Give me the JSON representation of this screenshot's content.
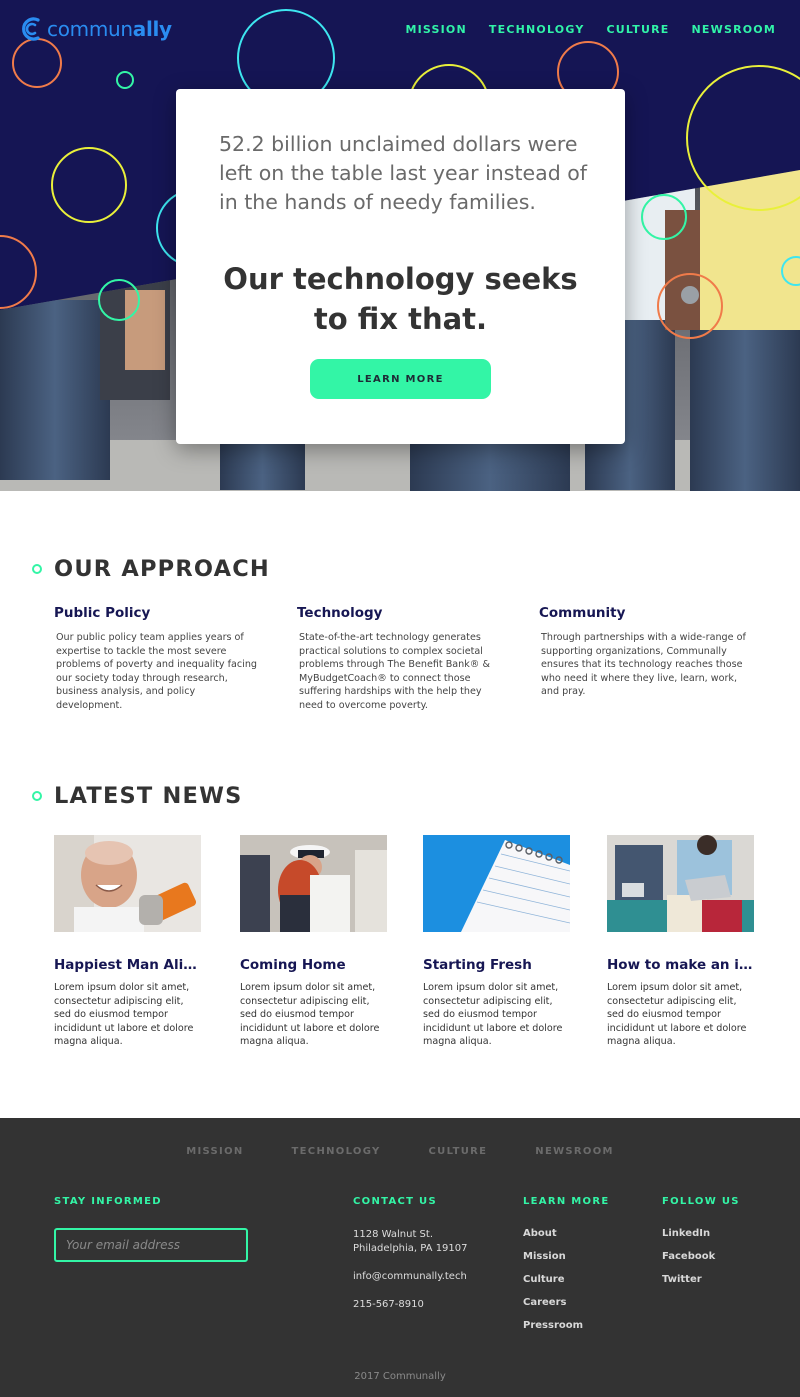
{
  "brand": {
    "logo_text_light": "commun",
    "logo_text_bold": "ally",
    "accent": "#33f5a6",
    "navy": "#151554",
    "logo_blue": "#2a8cf0"
  },
  "nav": {
    "items": [
      "MISSION",
      "TECHNOLOGY",
      "CULTURE",
      "NEWSROOM"
    ]
  },
  "hero": {
    "stat": "52.2 billion unclaimed dollars were left on the table last year instead of in the hands of needy families.",
    "headline_line1": "Our technology seeks",
    "headline_line2": "to fix that.",
    "button": "LEARN MORE"
  },
  "approach": {
    "title": "OUR APPROACH",
    "columns": [
      {
        "title": "Public Policy",
        "body": "Our public policy team applies years of expertise to tackle the most severe problems of poverty and inequality facing our society today through research, business analysis, and policy development."
      },
      {
        "title": "Technology",
        "body": "State-of-the-art technology generates practical solutions to complex societal problems through The Benefit Bank® & MyBudgetCoach® to connect those suffering hardships with the help they need to overcome poverty."
      },
      {
        "title": "Community",
        "body": "Through partnerships with a wide-range of supporting organizations, Communally ensures that its technology reaches those who need it where they live, learn, work, and pray."
      }
    ]
  },
  "news": {
    "title": "LATEST NEWS",
    "items": [
      {
        "title": "Happiest Man Alive?",
        "body": "Lorem ipsum dolor sit amet, consectetur adipiscing elit, sed do eiusmod tempor incididunt ut labore et dolore magna aliqua.",
        "image": "smiling-man-photo"
      },
      {
        "title": "Coming Home",
        "body": "Lorem ipsum dolor sit amet, consectetur adipiscing elit, sed do eiusmod tempor incididunt ut labore et dolore magna aliqua.",
        "image": "sailor-hug-photo"
      },
      {
        "title": "Starting Fresh",
        "body": "Lorem ipsum dolor sit amet, consectetur adipiscing elit, sed do eiusmod tempor incididunt ut labore et dolore magna aliqua.",
        "image": "notepad-photo"
      },
      {
        "title": "How to make an im...",
        "body": "Lorem ipsum dolor sit amet, consectetur adipiscing elit, sed do eiusmod tempor incididunt ut labore et dolore magna aliqua.",
        "image": "laptop-people-photo"
      }
    ]
  },
  "footer": {
    "nav": [
      "MISSION",
      "TECHNOLOGY",
      "CULTURE",
      "NEWSROOM"
    ],
    "stay_informed": {
      "title": "STAY INFORMED",
      "placeholder": "Your email address"
    },
    "contact": {
      "title": "CONTACT US",
      "address1": "1128 Walnut St.",
      "address2": "Philadelphia, PA 19107",
      "email": "info@communally.tech",
      "phone": "215-567-8910"
    },
    "learn_more": {
      "title": "LEARN MORE",
      "links": [
        "About",
        "Mission",
        "Culture",
        "Careers",
        "Pressroom"
      ]
    },
    "follow": {
      "title": "FOLLOW US",
      "links": [
        "LinkedIn",
        "Facebook",
        "Twitter"
      ]
    },
    "copyright": "2017 Communally"
  }
}
